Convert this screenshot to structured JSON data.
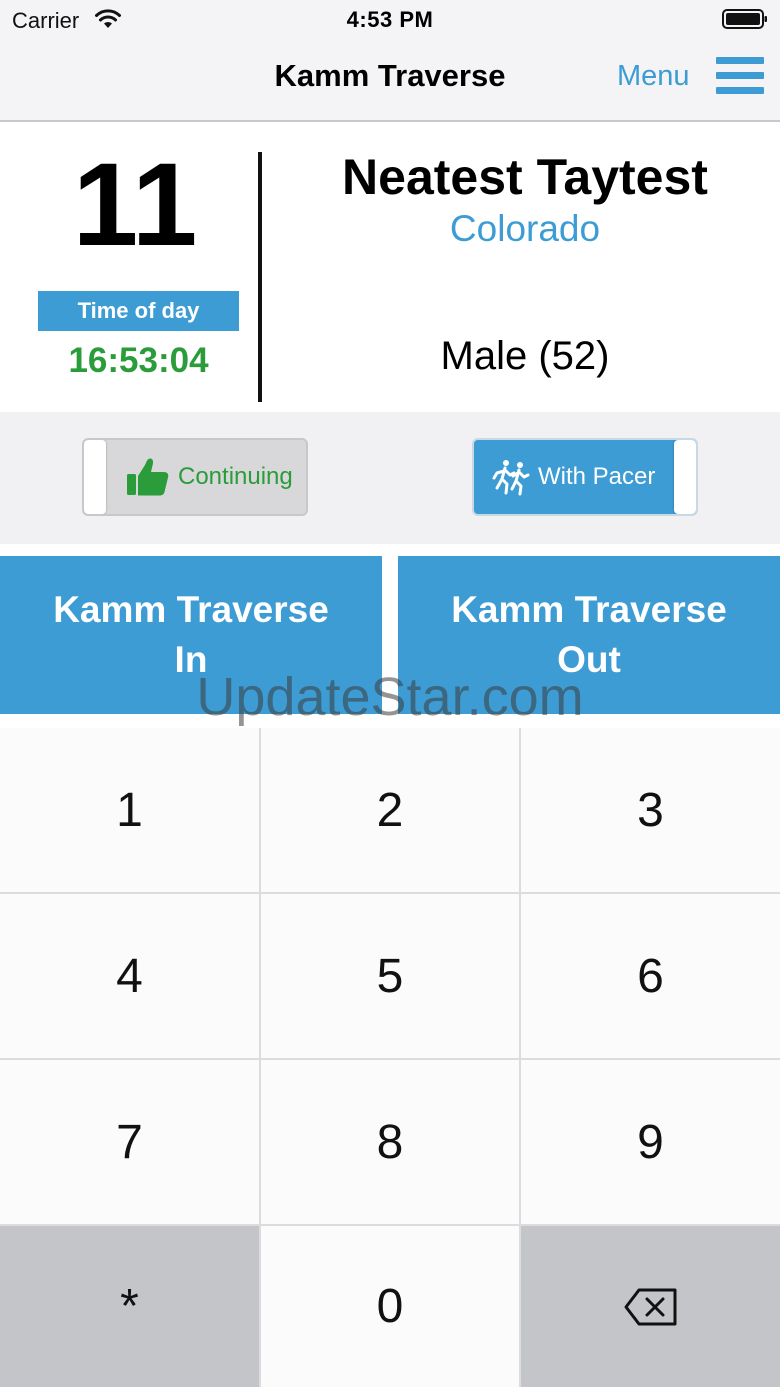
{
  "status_bar": {
    "carrier": "Carrier",
    "time": "4:53 PM"
  },
  "nav": {
    "title": "Kamm Traverse",
    "menu_label": "Menu"
  },
  "runner": {
    "bib": "11",
    "time_label": "Time of day",
    "time_value": "16:53:04",
    "name": "Neatest Taytest",
    "state": "Colorado",
    "gender_age": "Male (52)"
  },
  "toggles": {
    "continuing_label": "Continuing",
    "pacer_label": "With Pacer"
  },
  "actions": {
    "in_label": "Kamm Traverse In",
    "out_label": "Kamm Traverse Out"
  },
  "watermark": "UpdateStar.com",
  "keypad": {
    "keys": [
      "1",
      "2",
      "3",
      "4",
      "5",
      "6",
      "7",
      "8",
      "9",
      "*",
      "0"
    ]
  },
  "icons": {
    "wifi": "wifi-icon",
    "battery": "battery-icon",
    "menu": "hamburger-icon",
    "continuing": "thumbs-up-icon",
    "pacer": "runners-icon",
    "delete": "backspace-icon"
  },
  "colors": {
    "accent": "#3d9cd3",
    "green": "#2a9c3a",
    "toggle_off": "#d8d8da"
  }
}
